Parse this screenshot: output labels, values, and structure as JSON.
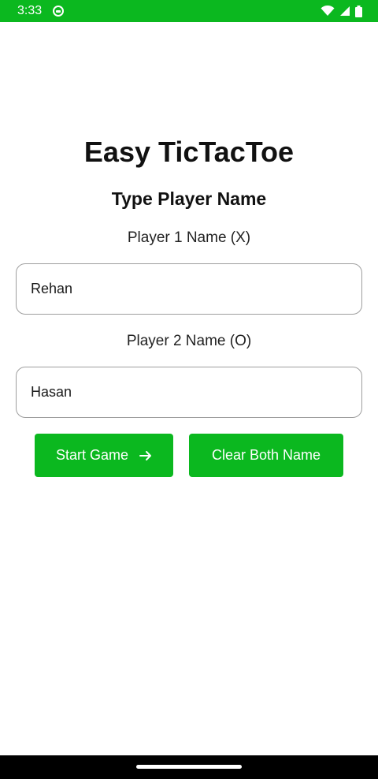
{
  "status_bar": {
    "time": "3:33",
    "background_color": "#0bb81f",
    "icons": [
      "app-notification-icon",
      "wifi-icon",
      "cell-signal-icon",
      "battery-icon"
    ]
  },
  "header": {
    "title": "Easy TicTacToe",
    "subtitle": "Type Player Name"
  },
  "form": {
    "player1_label": "Player 1 Name (X)",
    "player1_value": "Rehan",
    "player2_label": "Player 2 Name (O)",
    "player2_value": "Hasan"
  },
  "actions": {
    "start_label": "Start Game",
    "start_icon": "arrow-right-icon",
    "clear_label": "Clear Both Name",
    "button_color": "#0bb81f"
  }
}
